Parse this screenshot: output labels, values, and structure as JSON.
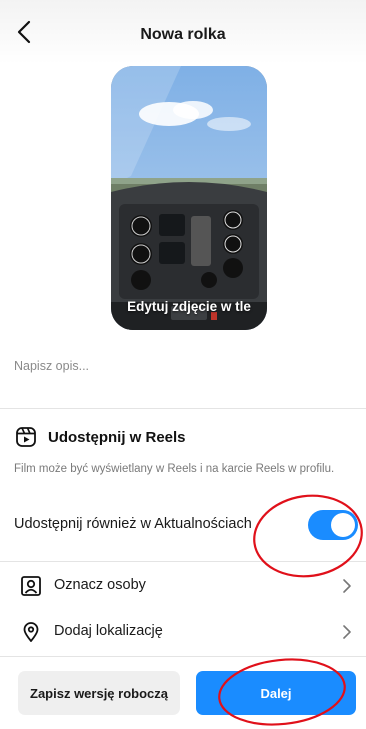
{
  "header": {
    "title": "Nowa rolka",
    "back_icon": "chevron-left-icon"
  },
  "preview": {
    "edit_cover_label": "Edytuj zdjęcie w tle"
  },
  "caption": {
    "placeholder": "Napisz opis...",
    "value": ""
  },
  "reels": {
    "icon": "reels-icon",
    "title": "Udostępnij w Reels",
    "description": "Film może być wyświetlany w Reels i na karcie Reels w profilu."
  },
  "feed_share": {
    "label": "Udostępnij również w Aktualnościach",
    "enabled": true
  },
  "options": [
    {
      "label": "Oznacz osoby",
      "icon": "tag-person-icon"
    },
    {
      "label": "Dodaj lokalizację",
      "icon": "location-pin-icon"
    }
  ],
  "footer": {
    "draft_label": "Zapisz wersję roboczą",
    "next_label": "Dalej"
  },
  "colors": {
    "accent": "#1a8cff",
    "annotation": "#e0101a"
  }
}
